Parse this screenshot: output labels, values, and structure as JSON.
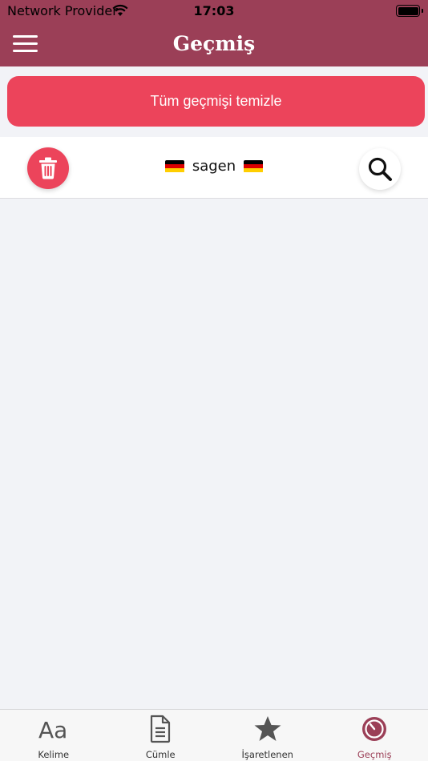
{
  "status": {
    "provider": "Network Provider",
    "time": "17:03"
  },
  "header": {
    "title": "Geçmiş"
  },
  "actions": {
    "clear_all_label": "Tüm geçmişi temizle"
  },
  "history": [
    {
      "word": "sagen",
      "source_flag": "german-flag",
      "target_flag": "german-flag"
    }
  ],
  "tabs": [
    {
      "label": "Kelime",
      "icon": "text-icon",
      "active": false
    },
    {
      "label": "Cümle",
      "icon": "document-icon",
      "active": false
    },
    {
      "label": "İşaretlenen",
      "icon": "star-icon",
      "active": false
    },
    {
      "label": "Geçmiş",
      "icon": "history-icon",
      "active": true
    }
  ],
  "colors": {
    "nav": "#9b3f57",
    "accent": "#ec445b",
    "background": "#f2f3f7"
  }
}
